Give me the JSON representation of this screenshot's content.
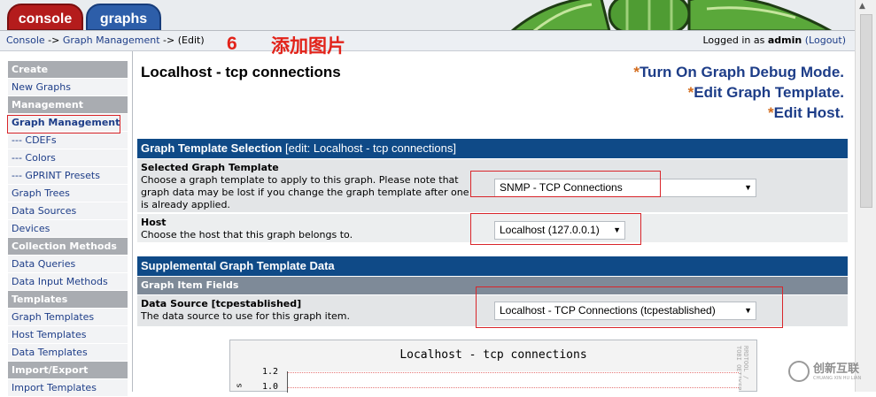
{
  "tabs": {
    "console": "console",
    "graphs": "graphs"
  },
  "breadcrumb": {
    "console": "Console",
    "sep1": " -> ",
    "graph_mgmt": "Graph Management",
    "sep2": " -> ",
    "current": "(Edit)"
  },
  "annotation": {
    "number": "6",
    "text": "添加图片"
  },
  "login": {
    "prefix": "Logged in as ",
    "user": "admin",
    "logout": "(Logout)"
  },
  "sidebar": {
    "create_header": "Create",
    "new_graphs": "New Graphs",
    "management_header": "Management",
    "graph_management": "Graph Management",
    "cdefs": "--- CDEFs",
    "colors": "--- Colors",
    "gprint": "--- GPRINT Presets",
    "graph_trees": "Graph Trees",
    "data_sources": "Data Sources",
    "devices": "Devices",
    "collection_header": "Collection Methods",
    "data_queries": "Data Queries",
    "data_input_methods": "Data Input Methods",
    "templates_header": "Templates",
    "graph_templates": "Graph Templates",
    "host_templates": "Host Templates",
    "data_templates": "Data Templates",
    "import_export_header": "Import/Export",
    "import_templates": "Import Templates"
  },
  "page_title": "Localhost - tcp connections",
  "actions": {
    "star": "*",
    "debug": "Turn On Graph Debug Mode.",
    "edit_template": "Edit Graph Template.",
    "edit_host": "Edit Host."
  },
  "section1": {
    "title": "Graph Template Selection",
    "edit": " [edit: Localhost - tcp connections]"
  },
  "row_template": {
    "label": "Selected Graph Template",
    "desc": "Choose a graph template to apply to this graph. Please note that graph data may be lost if you change the graph template after one is already applied.",
    "value": "SNMP - TCP Connections"
  },
  "row_host": {
    "label": "Host",
    "desc": "Choose the host that this graph belongs to.",
    "value": "Localhost (127.0.0.1)"
  },
  "section2": {
    "title": "Supplemental Graph Template Data"
  },
  "subheader": "Graph Item Fields",
  "row_ds": {
    "label": "Data Source [tcpestablished]",
    "desc": "The data source to use for this graph item.",
    "value": "Localhost - TCP Connections (tcpestablished)"
  },
  "graph": {
    "title": "Localhost - tcp connections",
    "side_text": "RRDTOOL / TOBI OETIKER",
    "ytick1": "1.2",
    "ytick2": "1.0",
    "ylabel_frag": "s"
  },
  "watermark": {
    "text": "创新互联",
    "sub": "CHUANG XIN HU LIAN"
  },
  "icons": {
    "dropdown": "triangle-down",
    "scroll_up": "triangle-up"
  }
}
